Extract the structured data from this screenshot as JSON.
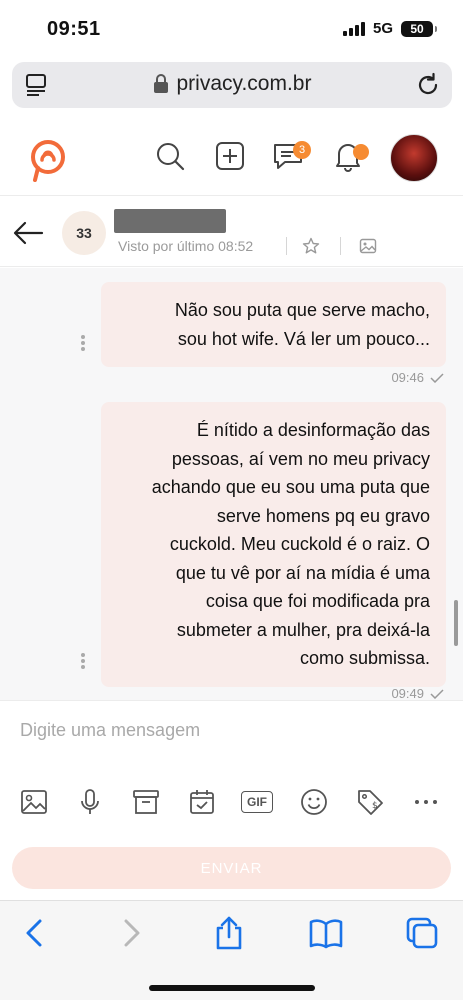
{
  "status_bar": {
    "time": "09:51",
    "network": "5G",
    "battery": "50"
  },
  "browser": {
    "url": "privacy.com.br"
  },
  "header": {
    "messages_badge": "3"
  },
  "chat": {
    "contact_initials": "33",
    "last_seen": "Visto por último 08:52"
  },
  "messages": [
    {
      "lines": [
        "Não sou puta que serve macho,",
        "sou hot wife. Vá ler um pouco..."
      ],
      "time": "09:46"
    },
    {
      "lines": [
        "É nítido a desinformação das",
        "pessoas, aí vem no meu privacy",
        "achando que eu sou uma puta que",
        "serve homens pq eu gravo",
        "cuckold. Meu cuckold é o raiz. O",
        "que tu vê por aí na mídia é uma",
        "coisa que foi modificada pra",
        "submeter a mulher, pra deixá-la",
        "como submissa."
      ],
      "time": "09:49"
    }
  ],
  "composer": {
    "placeholder": "Digite uma mensagem",
    "gif_label": "GIF",
    "send_label": "ENVIAR"
  },
  "colors": {
    "accent": "#f68b32",
    "bubble": "#f9ecea",
    "send_disabled": "#fbe5df",
    "ios_blue": "#1a73e8"
  }
}
